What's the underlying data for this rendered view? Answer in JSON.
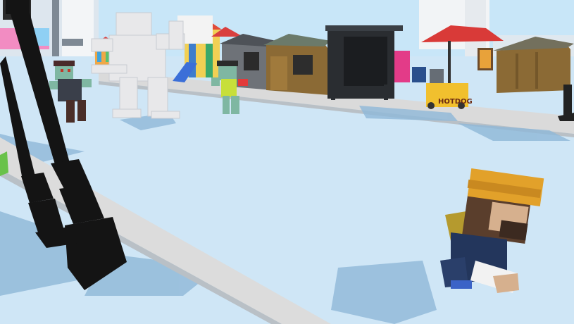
{
  "window": {
    "title": ""
  },
  "scene": {
    "sky_color": "#c8e6f8",
    "ground_color": "#cfe6f6",
    "shadow_color": "#8fb8d8",
    "curb_color": "#dcdcdc"
  },
  "signage": {
    "hotdog_cart_label": "HOTDOG"
  },
  "palette": {
    "lamp_post": "#141414",
    "shed_wood": "#8b6a35",
    "shed_gray": "#6e7278",
    "kiosk_dark": "#2a2d31",
    "umbrella_red": "#d93a38",
    "player_helmet": "#e2a12a",
    "player_jacket": "#23365c",
    "zombie_skin": "#7fb7a2",
    "statue_white": "#e8e8ea"
  },
  "entities": {
    "player": {
      "label": "player-character"
    },
    "zombies": [
      {
        "label": "zombie-left"
      },
      {
        "label": "zombie-center"
      }
    ],
    "statue": {
      "label": "white-robot-statue"
    }
  }
}
